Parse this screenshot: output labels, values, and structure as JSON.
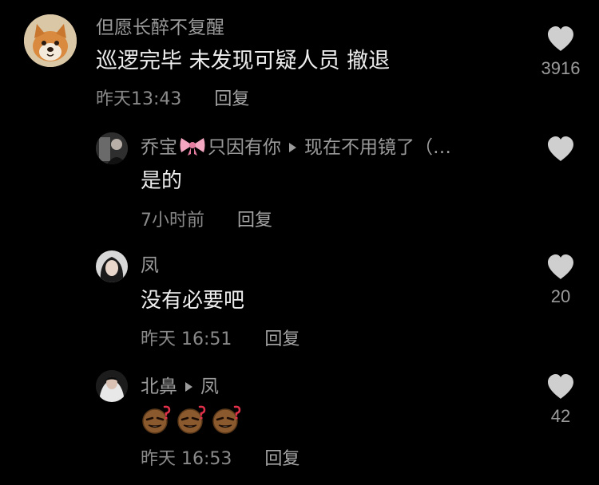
{
  "comments": [
    {
      "username": "但愿长醉不复醒",
      "text": "巡逻完毕 未发现可疑人员 撤退",
      "time": "昨天13:43",
      "reply_label": "回复",
      "likes": "3916",
      "avatar_icon": "shiba-dog-avatar"
    },
    {
      "username_part1": "乔宝",
      "username_part2": "只因有你",
      "reply_to": "现在不用镜了（…",
      "text": "是的",
      "time": "7小时前",
      "reply_label": "回复",
      "likes": "",
      "avatar_icon": "user-avatar"
    },
    {
      "username": "凤",
      "text": "没有必要吧",
      "time": "昨天 16:51",
      "reply_label": "回复",
      "likes": "20",
      "avatar_icon": "user-avatar"
    },
    {
      "username": "北鼻",
      "reply_to": "凤",
      "text": "",
      "time": "昨天 16:53",
      "reply_label": "回复",
      "likes": "42",
      "avatar_icon": "user-avatar",
      "emoji_icons": [
        "confused-emoji",
        "confused-emoji",
        "confused-emoji"
      ]
    }
  ],
  "colors": {
    "background": "#000000",
    "username": "#9b9b9b",
    "text": "#ededed",
    "meta": "#8a8a8a",
    "heart": "#cfcfcf"
  }
}
